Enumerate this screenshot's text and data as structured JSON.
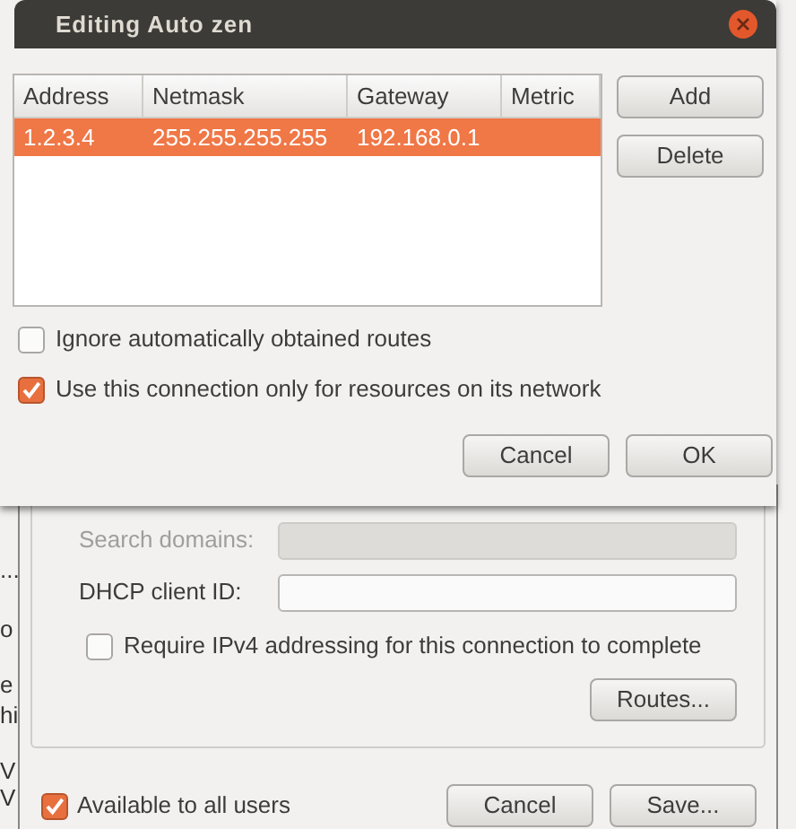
{
  "dialog": {
    "title": "Editing Auto zen",
    "table": {
      "columns": [
        "Address",
        "Netmask",
        "Gateway",
        "Metric"
      ],
      "rows": [
        {
          "cells": [
            "1.2.3.4",
            "255.255.255.255",
            "192.168.0.1"
          ],
          "selected": true
        }
      ]
    },
    "side_buttons": [
      "Add",
      "Delete"
    ],
    "options": [
      {
        "label": "Ignore automatically obtained routes",
        "checked": false
      },
      {
        "label": "Use this connection only for resources on its network",
        "checked": true
      }
    ],
    "buttons": [
      "Cancel",
      "OK"
    ]
  },
  "back_window": {
    "left_edge_text": [
      "...",
      "o",
      "e",
      "hi",
      "V",
      "V"
    ],
    "fields": [
      {
        "label": "Search domains:",
        "disabled": true
      },
      {
        "label": "DHCP client ID:",
        "disabled": false
      }
    ],
    "option": {
      "label": "Require IPv4 addressing for this connection to complete",
      "checked": false
    },
    "routes_button": "Routes...",
    "all_users": {
      "label": "Available to all users",
      "checked": true
    },
    "buttons": [
      "Cancel",
      "Save..."
    ]
  }
}
